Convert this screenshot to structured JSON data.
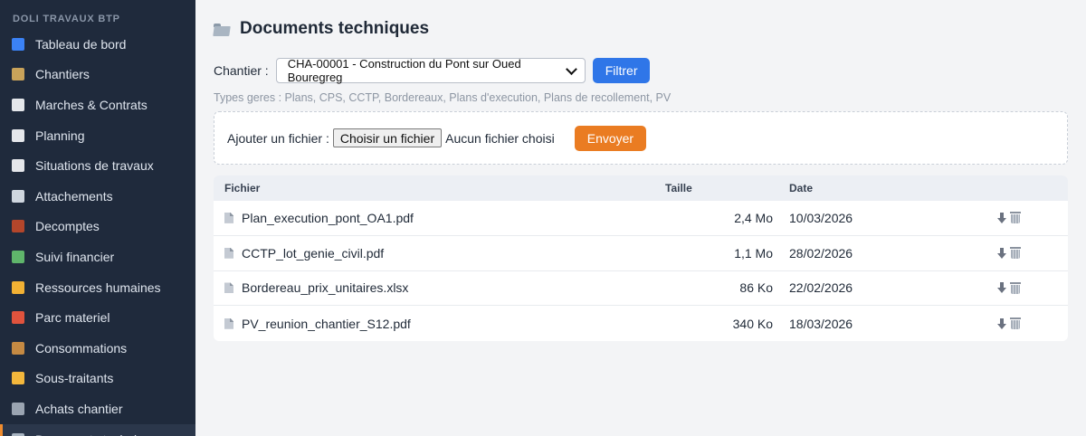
{
  "sidebar": {
    "brand": "DOLI TRAVAUX BTP",
    "items": [
      {
        "label": "Tableau de bord",
        "icon": "bar-chart-icon",
        "color": "#3b82f6"
      },
      {
        "label": "Chantiers",
        "icon": "crane-icon",
        "color": "#c9a35a"
      },
      {
        "label": "Marches & Contrats",
        "icon": "page-icon",
        "color": "#e5e7eb"
      },
      {
        "label": "Planning",
        "icon": "calendar-icon",
        "color": "#e5e7eb"
      },
      {
        "label": "Situations de travaux",
        "icon": "receipt-icon",
        "color": "#e5e7eb"
      },
      {
        "label": "Attachements",
        "icon": "ruler-icon",
        "color": "#cfd6df"
      },
      {
        "label": "Decomptes",
        "icon": "ledger-icon",
        "color": "#b4462b"
      },
      {
        "label": "Suivi financier",
        "icon": "money-icon",
        "color": "#5fb56b"
      },
      {
        "label": "Ressources humaines",
        "icon": "worker-icon",
        "color": "#f2b134"
      },
      {
        "label": "Parc materiel",
        "icon": "truck-icon",
        "color": "#e0533d"
      },
      {
        "label": "Consommations",
        "icon": "package-icon",
        "color": "#c58a43"
      },
      {
        "label": "Sous-traitants",
        "icon": "handshake-icon",
        "color": "#f3b73c"
      },
      {
        "label": "Achats chantier",
        "icon": "cart-icon",
        "color": "#9aa4b1"
      },
      {
        "label": "Documents techniques",
        "icon": "folder-icon",
        "color": "#a9b5c2"
      }
    ]
  },
  "header": {
    "title": "Documents techniques"
  },
  "filter": {
    "label": "Chantier :",
    "selected": "CHA-00001 - Construction du Pont sur Oued Bouregreg",
    "button": "Filtrer"
  },
  "types_text": "Types geres : Plans, CPS, CCTP, Bordereaux, Plans d'execution, Plans de recollement, PV",
  "upload": {
    "label": "Ajouter un fichier :",
    "choose_button": "Choisir un fichier",
    "no_file": "Aucun fichier choisi",
    "send_button": "Envoyer"
  },
  "table": {
    "headers": {
      "file": "Fichier",
      "size": "Taille",
      "date": "Date"
    },
    "rows": [
      {
        "file": "Plan_execution_pont_OA1.pdf",
        "size": "2,4 Mo",
        "date": "10/03/2026"
      },
      {
        "file": "CCTP_lot_genie_civil.pdf",
        "size": "1,1 Mo",
        "date": "28/02/2026"
      },
      {
        "file": "Bordereau_prix_unitaires.xlsx",
        "size": "86 Ko",
        "date": "22/02/2026"
      },
      {
        "file": "PV_reunion_chantier_S12.pdf",
        "size": "340 Ko",
        "date": "18/03/2026"
      }
    ]
  }
}
